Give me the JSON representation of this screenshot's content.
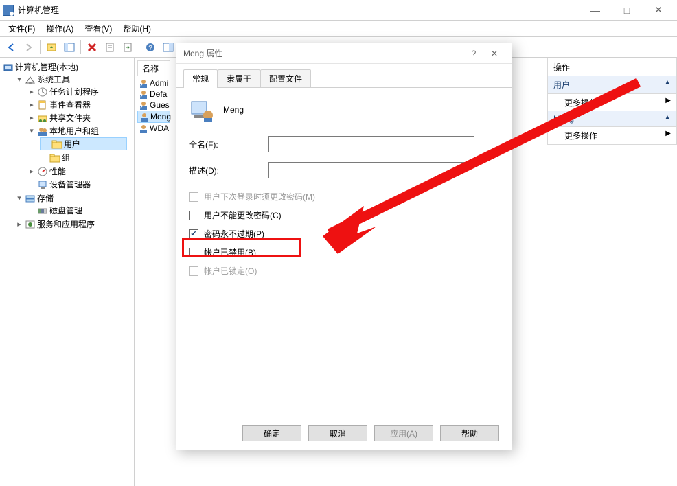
{
  "window": {
    "title": "计算机管理",
    "min": "—",
    "max": "□",
    "close": "✕"
  },
  "menu": {
    "file": "文件(F)",
    "action": "操作(A)",
    "view": "查看(V)",
    "help": "帮助(H)"
  },
  "tree": {
    "root": "计算机管理(本地)",
    "sys_tools": "系统工具",
    "task": "任务计划程序",
    "event": "事件查看器",
    "shared": "共享文件夹",
    "local_users": "本地用户和组",
    "users": "用户",
    "groups": "组",
    "perf": "性能",
    "devmgr": "设备管理器",
    "storage": "存储",
    "diskmgr": "磁盘管理",
    "services": "服务和应用程序"
  },
  "list": {
    "header_name": "名称",
    "items": [
      "Admi",
      "Defa",
      "Gues",
      "Meng",
      "WDA"
    ]
  },
  "actions": {
    "title": "操作",
    "group1": "用户",
    "more": "更多操作",
    "group2": "Meng"
  },
  "dialog": {
    "title": "Meng 属性",
    "help": "?",
    "close": "✕",
    "tabs": {
      "general": "常规",
      "member": "隶属于",
      "profile": "配置文件"
    },
    "username": "Meng",
    "fullname_label": "全名(F):",
    "fullname_value": "",
    "desc_label": "描述(D):",
    "desc_value": "",
    "chk1": "用户下次登录时须更改密码(M)",
    "chk2": "用户不能更改密码(C)",
    "chk3": "密码永不过期(P)",
    "chk4": "帐户已禁用(B)",
    "chk5": "帐户已锁定(O)",
    "ok": "确定",
    "cancel": "取消",
    "apply": "应用(A)",
    "helpbtn": "帮助"
  }
}
